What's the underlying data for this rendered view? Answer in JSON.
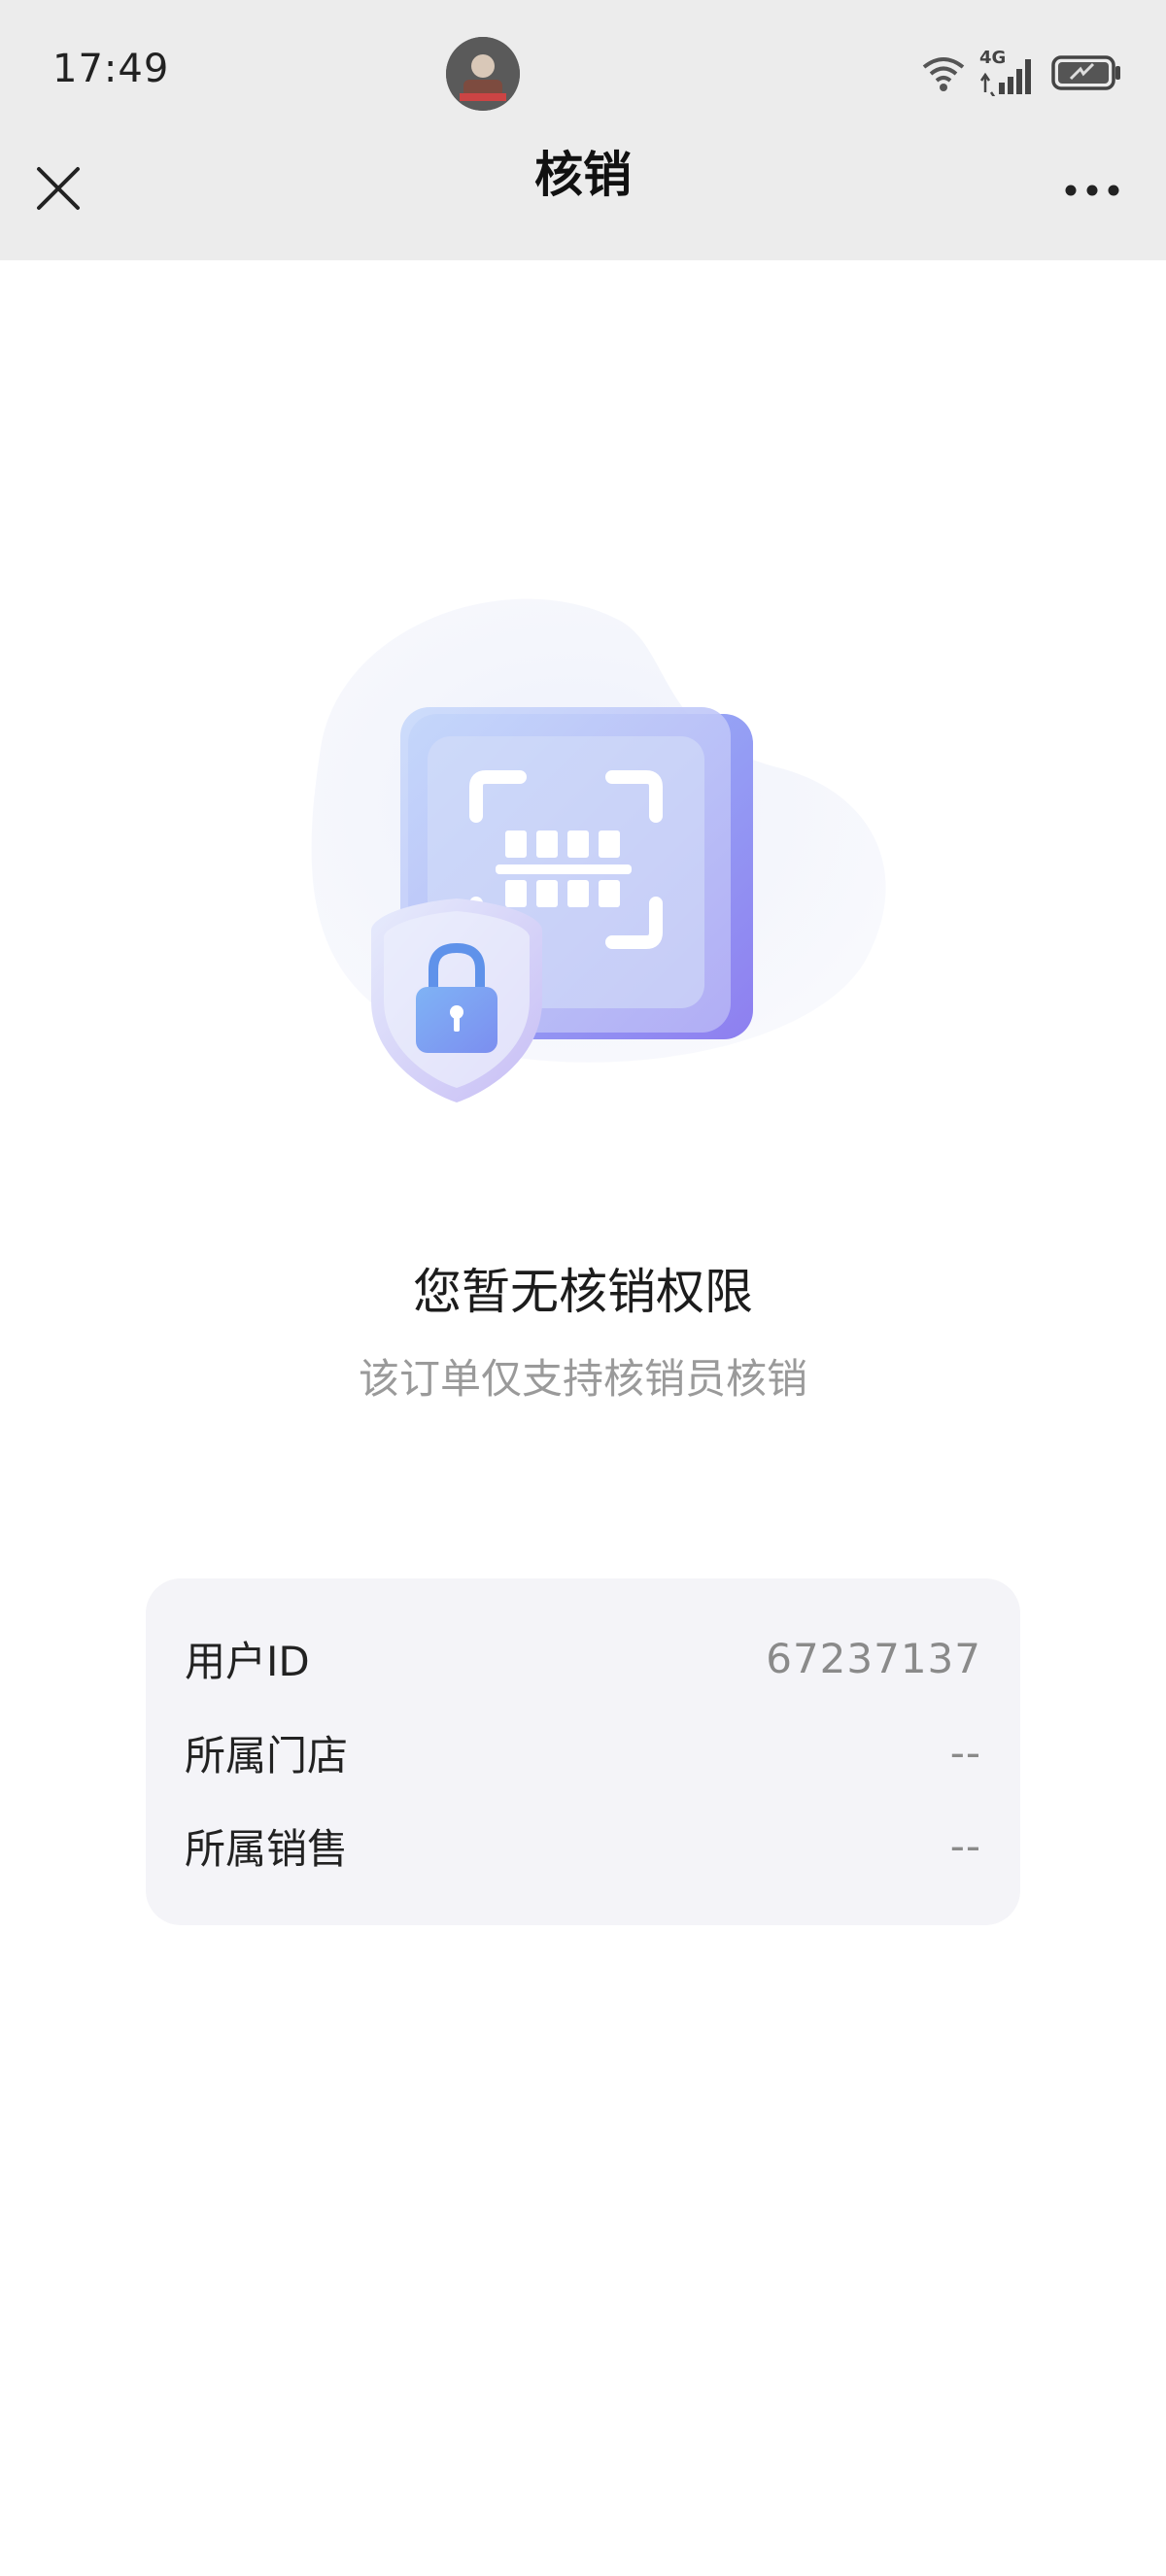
{
  "status_bar": {
    "time": "17:49",
    "network_label": "4G",
    "icons": [
      "avatar-image",
      "wifi-icon",
      "signal-icon",
      "battery-icon"
    ]
  },
  "nav": {
    "title": "核销",
    "close_icon": "close-icon",
    "more_icon": "more-icon"
  },
  "message": {
    "title": "您暂无核销权限",
    "subtitle": "该订单仅支持核销员核销"
  },
  "info": {
    "rows": [
      {
        "label": "用户ID",
        "value": "67237137"
      },
      {
        "label": "所属门店",
        "value": "--"
      },
      {
        "label": "所属销售",
        "value": "--"
      }
    ]
  },
  "colors": {
    "topbar_bg": "#ececec",
    "card_bg": "#f4f4f8",
    "illustration_blue": "#8fb3f7",
    "illustration_purple": "#a99cf0"
  }
}
